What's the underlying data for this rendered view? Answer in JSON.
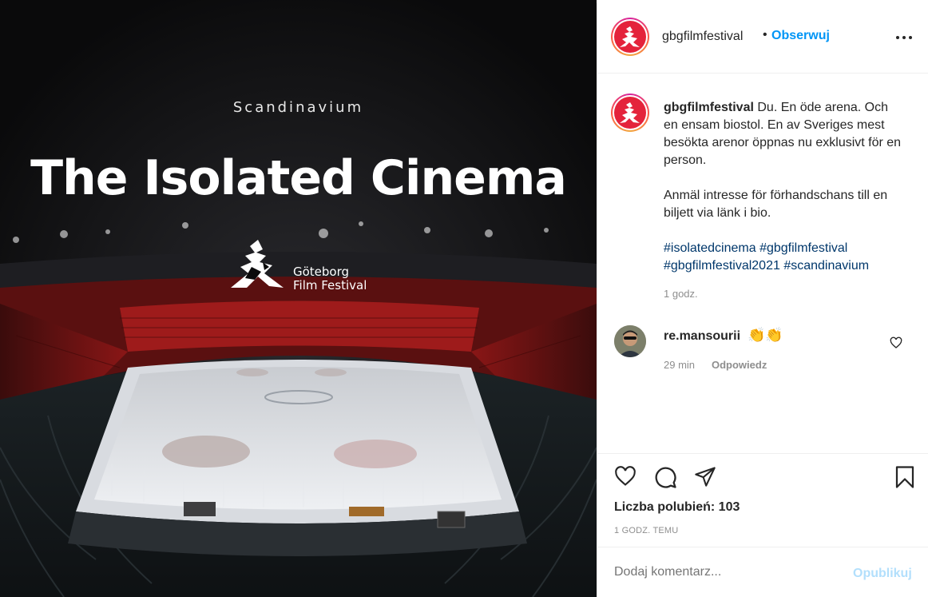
{
  "post": {
    "poster": {
      "subtitle": "Scandinavium",
      "title": "The Isolated Cinema",
      "logo_line1": "Göteborg",
      "logo_line2": "Film Festival"
    }
  },
  "header": {
    "username": "gbgfilmfestival",
    "separator": "•",
    "follow_label": "Obserwuj",
    "avatar_icon": "gbg-festival-logo-icon",
    "more_icon": "more-options-icon"
  },
  "caption": {
    "username": "gbgfilmfestival",
    "text_1": "Du. En öde arena. Och en ensam biostol. En av Sveriges mest besökta arenor öppnas nu exklusivt för en person.",
    "text_2": "Anmäl intresse för förhandschans till en biljett via länk i bio.",
    "hashtags": [
      "#isolatedcinema",
      "#gbgfilmfestival",
      "#gbgfilmfestival2021",
      "#scandinavium"
    ],
    "time": "1 godz."
  },
  "comment": {
    "username": "re.mansourii",
    "text": "👏👏",
    "time": "29 min",
    "reply_label": "Odpowiedz",
    "like_icon": "heart-outline-icon"
  },
  "actions": {
    "icons": [
      "heart-icon",
      "comment-icon",
      "share-icon",
      "bookmark-icon"
    ],
    "likes": "Liczba polubień: 103",
    "posted": "1 GODZ. TEMU"
  },
  "add_comment": {
    "placeholder": "Dodaj komentarz...",
    "publish_label": "Opublikuj"
  },
  "colors": {
    "follow": "#0095f6",
    "publish_disabled": "#b2dffc",
    "hashtag": "#00376b",
    "brand_red": "#e4233b"
  }
}
